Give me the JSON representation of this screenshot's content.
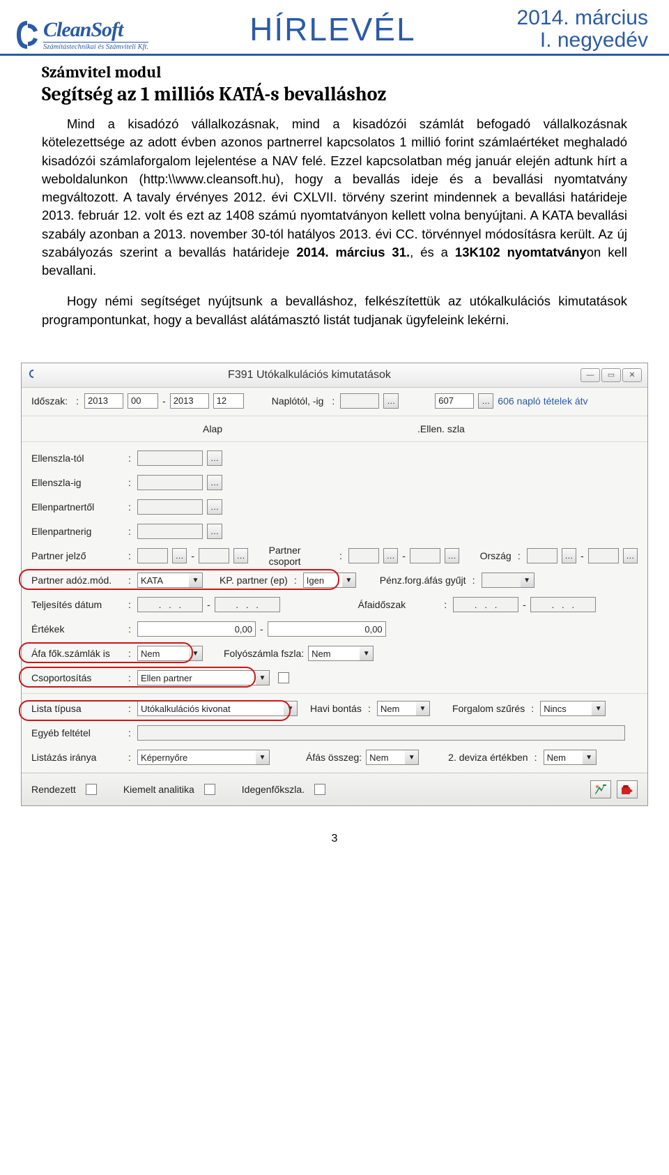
{
  "header": {
    "company": "CleanSoft",
    "company_sub": "Számítástechnikai és Számviteli Kft.",
    "newsletter": "HÍRLEVÉL",
    "date_line1": "2014. március",
    "date_line2": "I. negyedév"
  },
  "article": {
    "section": "Számvitel modul",
    "title": "Segítség az 1 milliós KATÁ-s bevalláshoz",
    "p1_a": "Mind a kisadózó vállalkozásnak, mind a kisadózói számlát befogadó vállalkozásnak kötelezettsége az adott évben azonos partnerrel kapcsolatos 1 millió forint számlaértéket meghaladó kisadózói számlaforgalom lejelentése a NAV felé. Ezzel kapcsolatban még január elején adtunk hírt a weboldalunkon (http:\\\\www.cleansoft.hu), hogy a bevallás ideje és a bevallási nyomtatvány megváltozott. A tavaly érvényes 2012. évi CXLVII. törvény szerint mindennek a bevallási határideje 2013. február 12. volt és ezt az 1408 számú nyomtatványon kellett volna benyújtani. A KATA bevallási szabály azonban a 2013. november 30-tól hatályos 2013. évi CC. törvénnyel módosításra került. Az új szabályozás szerint a bevallás határideje ",
    "p1_b": "2014. március 31.",
    "p1_c": ", és a ",
    "p1_d": "13K102 nyomtatvány",
    "p1_e": "on kell bevallani.",
    "p2": "Hogy némi segítséget nyújtsunk a bevalláshoz, felkészítettük az utókalkulációs kimutatások programpontunkat, hogy a bevallást alátámasztó listát tudjanak ügyfeleink lekérni."
  },
  "dialog": {
    "title": "F391 Utókalkulációs kimutatások",
    "hdr": {
      "idoszak_lbl": "Időszak:",
      "y_from": "2013",
      "m_from": "00",
      "y_to": "2013",
      "m_to": "12",
      "naplo_lbl": "Naplótól, -ig",
      "naplo_to": "607",
      "naplo_desc": "606 napló tételek átv"
    },
    "tabs": {
      "alap": "Alap",
      "ellen": ".Ellen. szla"
    },
    "rows": {
      "ellenszla_tol": "Ellenszla-tól",
      "ellenszla_ig": "Ellenszla-ig",
      "ellenpartnertol": "Ellenpartnertől",
      "ellenpartnerig": "Ellenpartnerig",
      "partner_jelzo": "Partner jelző",
      "partner_csoport": "Partner csoport",
      "orszag": "Ország",
      "partner_adoz": "Partner adóz.mód.",
      "partner_adoz_val": "KATA",
      "kp_partner": "KP. partner (ep)",
      "kp_partner_val": "Igen",
      "penzforg": "Pénz.forg.áfás gyűjt",
      "telj_datum": "Teljesítés dátum",
      "afaidoszak": "Áfaidőszak",
      "ertekek": "Értékek",
      "ertek_from": "0,00",
      "ertek_to": "0,00",
      "afa_fok": "Áfa fők.számlák is",
      "afa_fok_val": "Nem",
      "folyoszla": "Folyószámla fszla:",
      "folyoszla_val": "Nem",
      "csoportositas": "Csoportosítás",
      "csoportositas_val": "Ellen partner",
      "lista_tipusa": "Lista típusa",
      "lista_tipusa_val": "Utókalkulációs kivonat",
      "havi_bontas": "Havi bontás",
      "havi_bontas_val": "Nem",
      "forgalom": "Forgalom szűrés",
      "forgalom_val": "Nincs",
      "egyeb": "Egyéb feltétel",
      "listazas_iranya": "Listázás iránya",
      "listazas_iranya_val": "Képernyőre",
      "afas_osszeg": "Áfás összeg:",
      "afas_osszeg_val": "Nem",
      "deviza2": "2. deviza értékben",
      "deviza2_val": "Nem"
    },
    "footer": {
      "rendezett": "Rendezett",
      "kiemelt": "Kiemelt analitika",
      "idegen": "Idegenfőkszla."
    }
  },
  "pagenum": "3"
}
